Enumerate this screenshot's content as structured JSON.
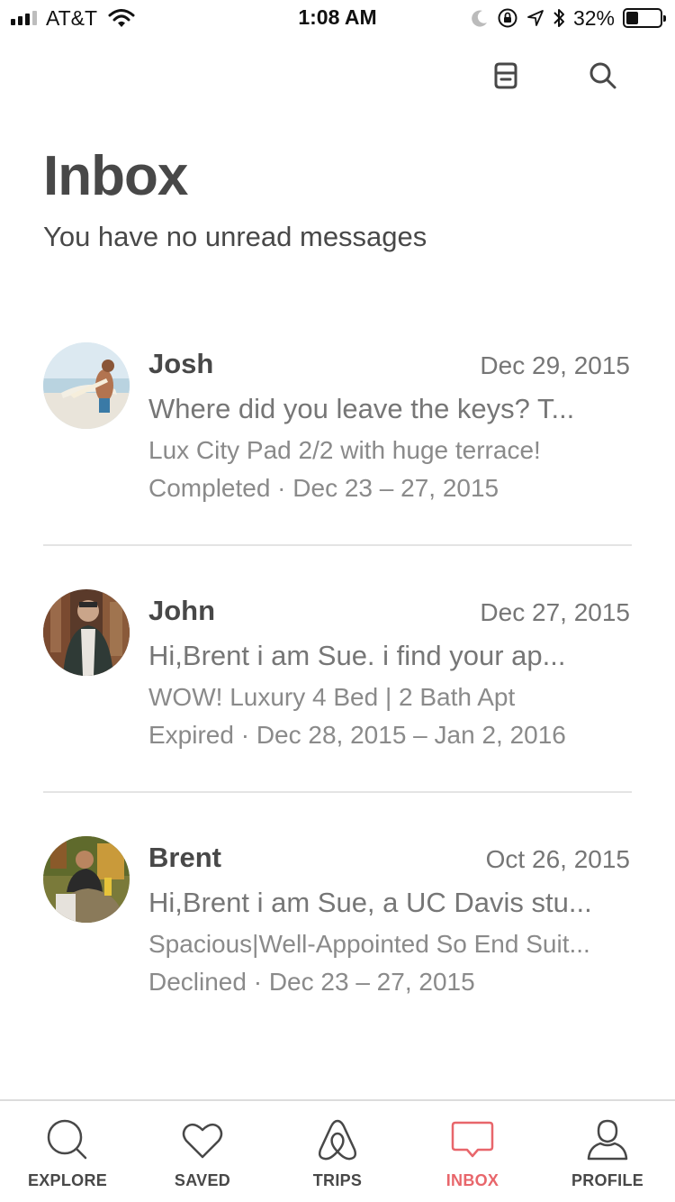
{
  "status_bar": {
    "carrier": "AT&T",
    "time": "1:08 AM",
    "battery_percent": "32%",
    "battery_level": 0.32,
    "icons": [
      "signal-icon",
      "wifi-icon",
      "moon-icon",
      "rotation-lock-icon",
      "location-icon",
      "bluetooth-icon",
      "battery-icon"
    ]
  },
  "toolbar": {
    "icons": [
      "archive-icon",
      "search-icon"
    ]
  },
  "header": {
    "title": "Inbox",
    "subtitle": "You have no unread messages"
  },
  "threads": [
    {
      "name": "Josh",
      "date": "Dec 29, 2015",
      "snippet": "Where did you leave the keys?  T...",
      "listing": "Lux City Pad 2/2 with huge terrace!",
      "status": "Completed · Dec 23 – 27, 2015"
    },
    {
      "name": "John",
      "date": "Dec 27, 2015",
      "snippet": "Hi,Brent  i am Sue.  i find your ap...",
      "listing": "WOW! Luxury 4 Bed | 2 Bath Apt",
      "status": "Expired · Dec 28, 2015 – Jan 2, 2016"
    },
    {
      "name": "Brent",
      "date": "Oct 26, 2015",
      "snippet": "Hi,Brent  i am Sue, a UC Davis stu...",
      "listing": "Spacious|Well-Appointed So End Suit...",
      "status": "Declined · Dec 23 – 27, 2015"
    }
  ],
  "tab_bar": {
    "active": "INBOX",
    "active_color": "#e8666b",
    "tabs": [
      {
        "label": "EXPLORE",
        "icon": "search-icon"
      },
      {
        "label": "SAVED",
        "icon": "heart-icon"
      },
      {
        "label": "TRIPS",
        "icon": "airbnb-logo-icon"
      },
      {
        "label": "INBOX",
        "icon": "message-bubble-icon"
      },
      {
        "label": "PROFILE",
        "icon": "user-icon"
      }
    ]
  }
}
